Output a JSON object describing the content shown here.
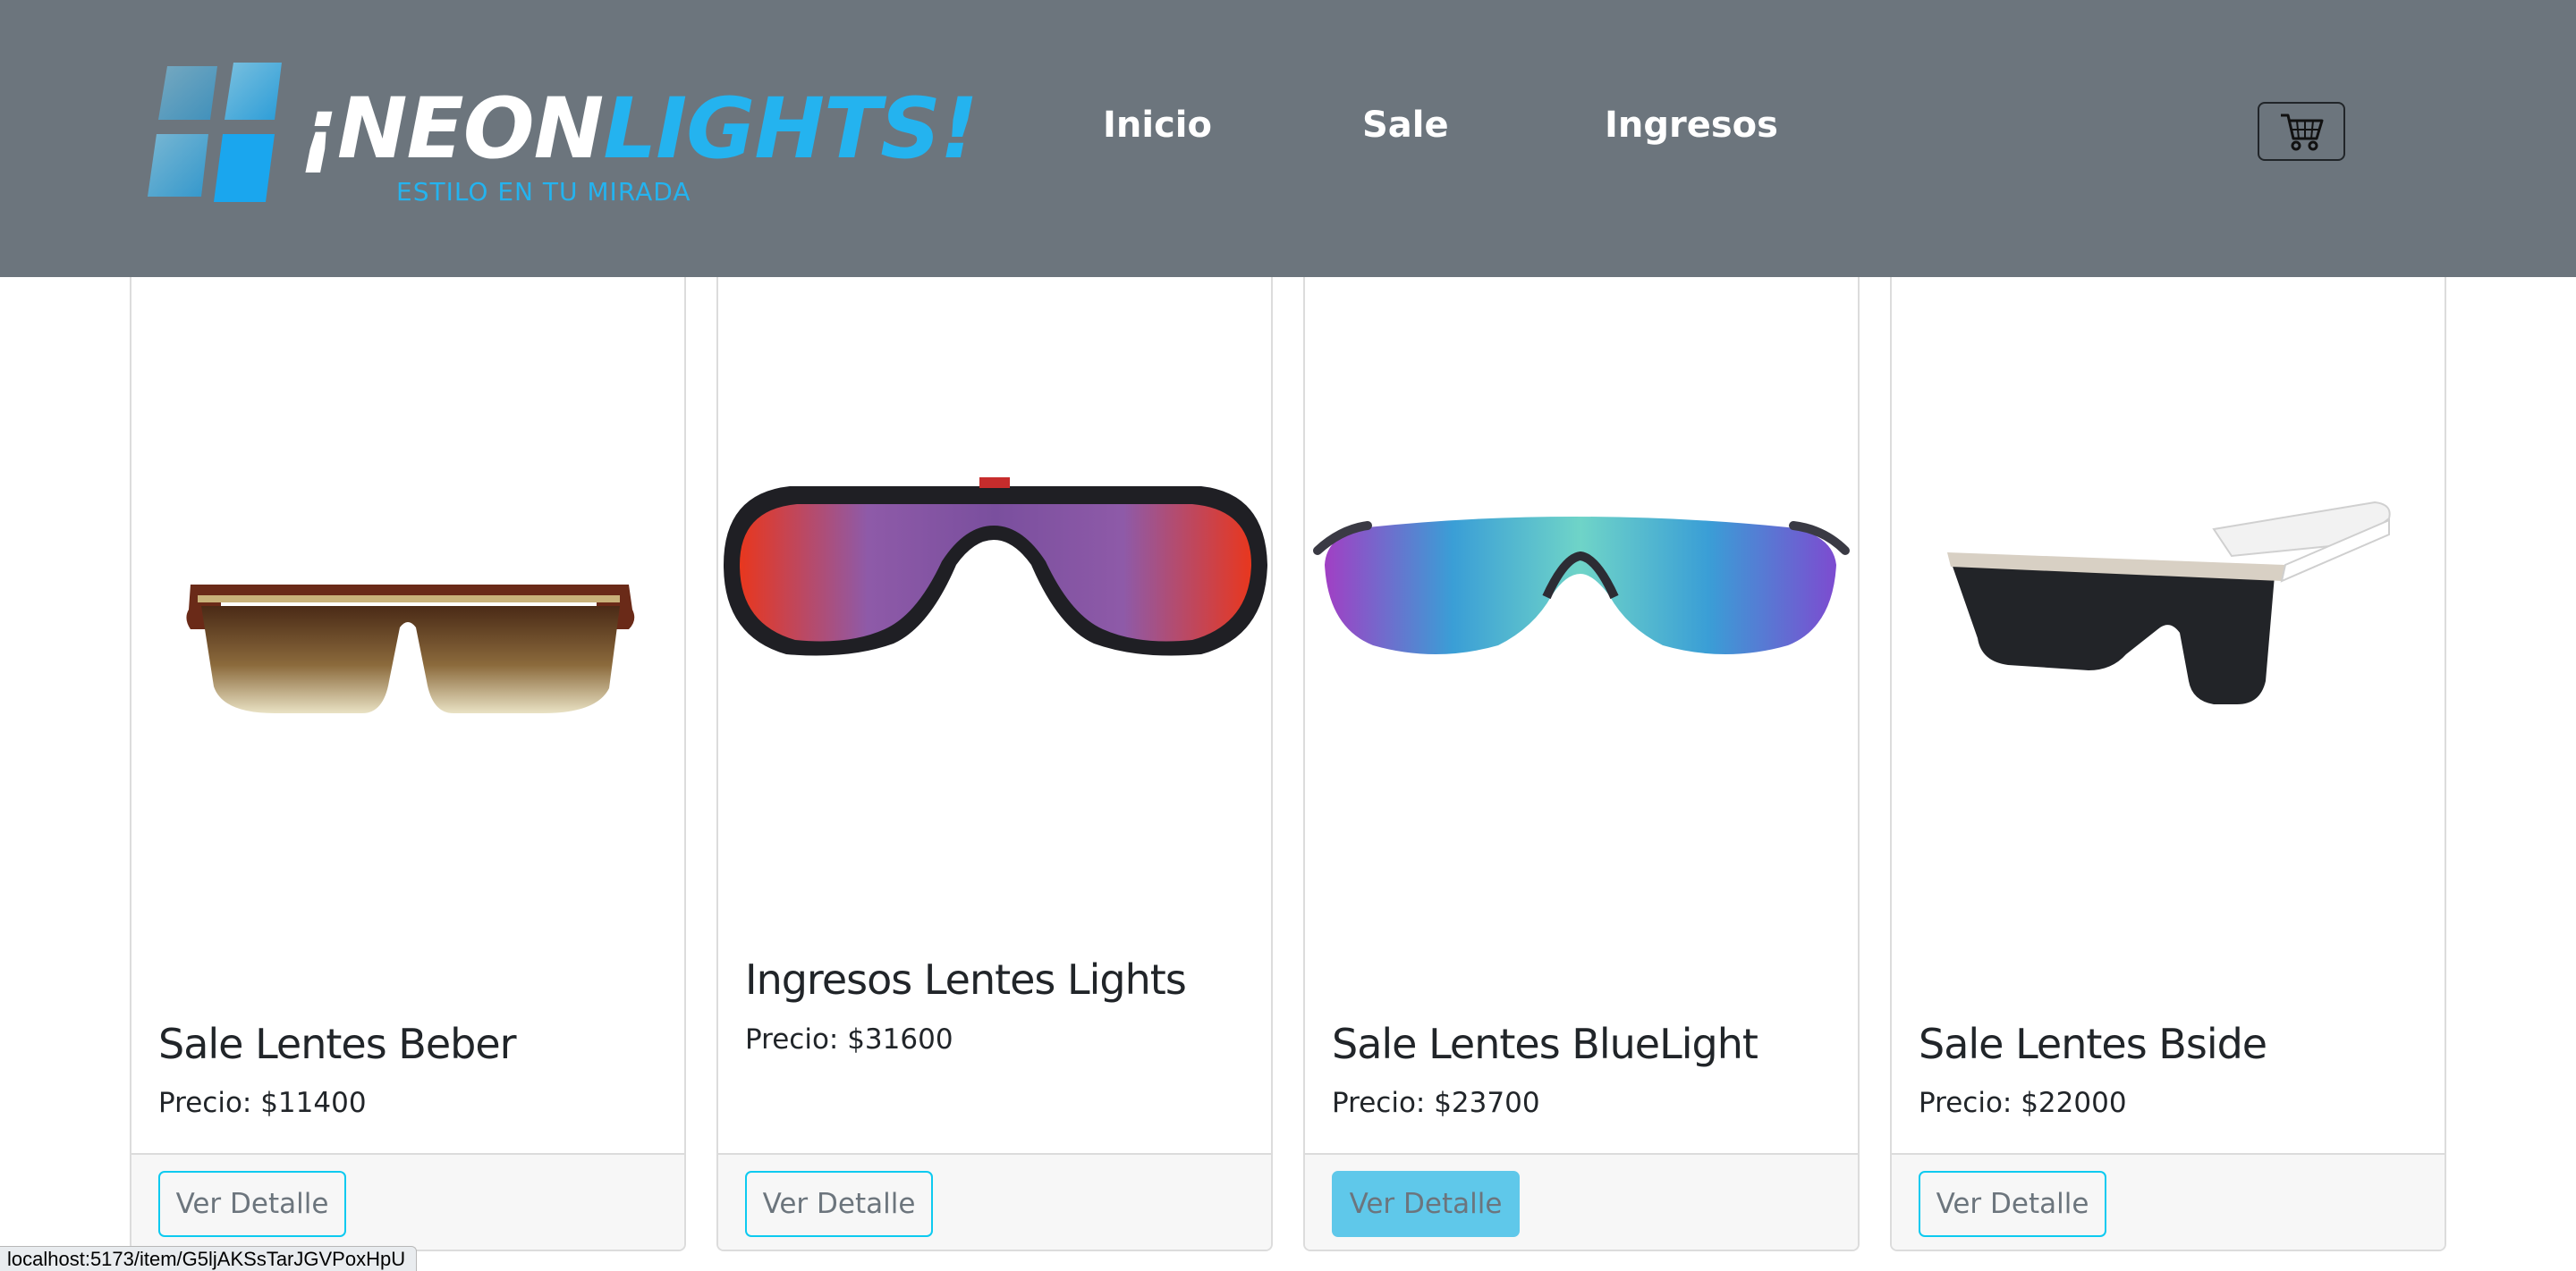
{
  "header": {
    "logo": {
      "name_part1": "¡NEON",
      "name_part2": "LIGHTS!",
      "tagline": "ESTILO EN TU MIRADA"
    },
    "nav": [
      "Inicio",
      "Sale",
      "Ingresos"
    ],
    "cart_icon": "shopping-cart-icon",
    "colors": {
      "background": "#6c757d",
      "brand_accent": "#24b3ef",
      "nav_text": "#ffffff"
    }
  },
  "products": [
    {
      "title": "Sale Lentes Beber",
      "price": "Precio: $11400",
      "button": "Ver Detalle",
      "image": "brown-gradient-shield-sunglasses"
    },
    {
      "title": "Ingresos Lentes Lights",
      "price": "Precio: $31600",
      "button": "Ver Detalle",
      "image": "purple-red-sport-sunglasses"
    },
    {
      "title": "Sale Lentes BlueLight",
      "price": "Precio: $23700",
      "button": "Ver Detalle",
      "image": "blue-purple-rimless-sunglasses",
      "hovered": true
    },
    {
      "title": "Sale Lentes Bside",
      "price": "Precio: $22000",
      "button": "Ver Detalle",
      "image": "black-white-flat-top-sunglasses"
    }
  ],
  "status_bar": {
    "url": "localhost:5173/item/G5ljAKSsTarJGVPoxHpU"
  },
  "colors": {
    "button_border": "#0dcaf0",
    "button_hover": "#5fc8ea",
    "card_border": "#dcdcdc"
  }
}
